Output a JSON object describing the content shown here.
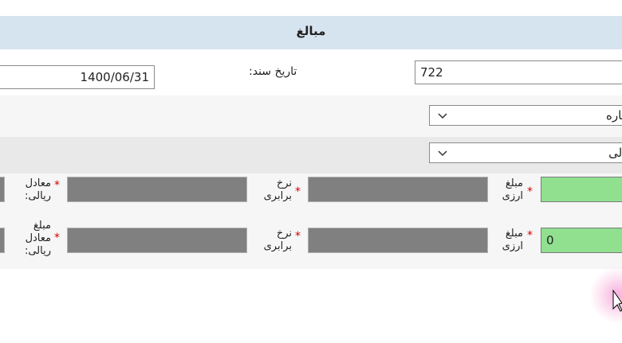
{
  "header": {
    "title": "مبالغ"
  },
  "doc": {
    "number_value": "722",
    "date_label": "تاریخ سند:",
    "date_value": "1400/06/31"
  },
  "selects": {
    "first_value": "جاره",
    "second_value": "یالی"
  },
  "grid": {
    "row1": {
      "amount_label_1": "مبلغ",
      "amount_label_2": "ارزی",
      "rate_label_1": "نرخ",
      "rate_label_2": "برابری",
      "equiv_label_1": "معادل",
      "equiv_label_2": "ریالی:",
      "amount_value": ""
    },
    "row2": {
      "amount_label_1": "مبلغ",
      "amount_label_2": "ارزی",
      "rate_label_1": "نرخ",
      "rate_label_2": "برابری",
      "equiv_label_0": "مبلغ",
      "equiv_label_1": "معادل",
      "equiv_label_2": "ریالی:",
      "amount_value": "0"
    },
    "required_mark": "*"
  },
  "colors": {
    "header_bg": "#d6e4f0",
    "readonly_field": "#808080",
    "editable_field": "#90e090",
    "required": "#d40000"
  }
}
